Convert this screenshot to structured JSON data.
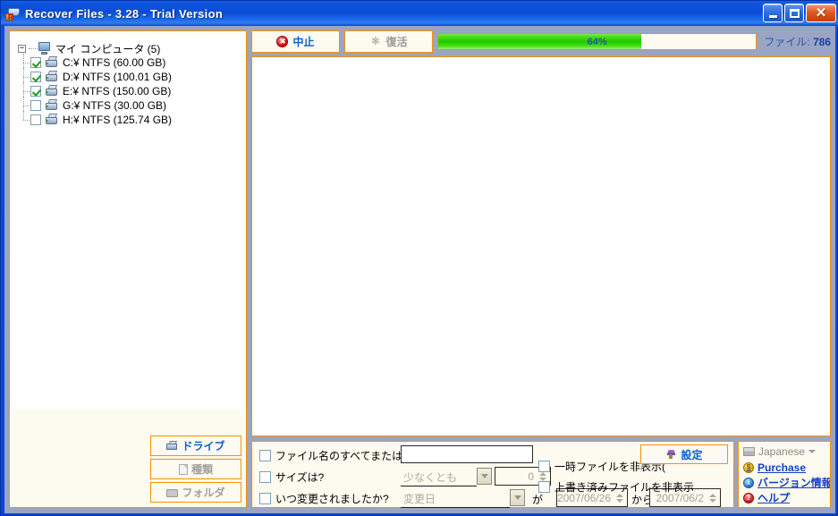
{
  "window": {
    "title": "Recover Files - 3.28 - Trial Version",
    "icon": "disk-recovery-icon",
    "minimize_label": "",
    "maximize_label": "",
    "close_label": "✕"
  },
  "tree": {
    "root": {
      "label": "マイ コンピュータ (5)",
      "expander": "−"
    },
    "drives": [
      {
        "label": "C:¥  NTFS  (60.00 GB)",
        "checked": true
      },
      {
        "label": "D:¥  NTFS  (100.01 GB)",
        "checked": true
      },
      {
        "label": "E:¥  NTFS  (150.00 GB)",
        "checked": true
      },
      {
        "label": "G:¥  NTFS  (30.00 GB)",
        "checked": false
      },
      {
        "label": "H:¥  NTFS  (125.74 GB)",
        "checked": false
      }
    ]
  },
  "mode_buttons": [
    {
      "label": "ドライブ",
      "icon": "drive-icon",
      "state": "active"
    },
    {
      "label": "種類",
      "icon": "page-icon",
      "state": "disabled"
    },
    {
      "label": "フォルダ",
      "icon": "folder-icon",
      "state": "disabled"
    }
  ],
  "toolbar": {
    "stop_label": "中止",
    "stop_icon": "stop-circle-icon",
    "recover_label": "復活",
    "recover_icon": "recover-icon",
    "progress_percent": 64,
    "progress_text": "64%",
    "file_count_label": "ファイル:",
    "file_count_value": "786"
  },
  "filters": {
    "filename": {
      "label": "ファイル名のすべてまたは一部",
      "value": "",
      "checked": false
    },
    "size": {
      "label": "サイズは?",
      "operator": "少なくとも",
      "value": "0",
      "checked": false
    },
    "modified": {
      "label": "いつ変更されましたか?",
      "field": "変更日",
      "from_label": "が",
      "from_date": "2007/06/26",
      "to_label": "から",
      "to_date": "2007/06/2",
      "checked": false
    },
    "hide_temp": {
      "label": "一時ファイルを非表示(",
      "checked": false
    },
    "hide_overwritten": {
      "label": "上書き済みファイルを非表示",
      "checked": false
    },
    "settings_label": "設定",
    "settings_icon": "gem-icon"
  },
  "info_panel": {
    "language": "Japanese",
    "language_icon": "flag-icon",
    "links": [
      {
        "label": "Purchase",
        "icon": "purchase-icon"
      },
      {
        "label": "バージョン情報",
        "icon": "version-icon"
      },
      {
        "label": "ヘルプ",
        "icon": "help-icon"
      }
    ]
  },
  "colors": {
    "accent_orange": "#f29400",
    "panel_bg": "#fdfaef",
    "link_blue": "#1340c8",
    "progress_green": "#1fc800",
    "title_blue": "#0b4cd6"
  }
}
